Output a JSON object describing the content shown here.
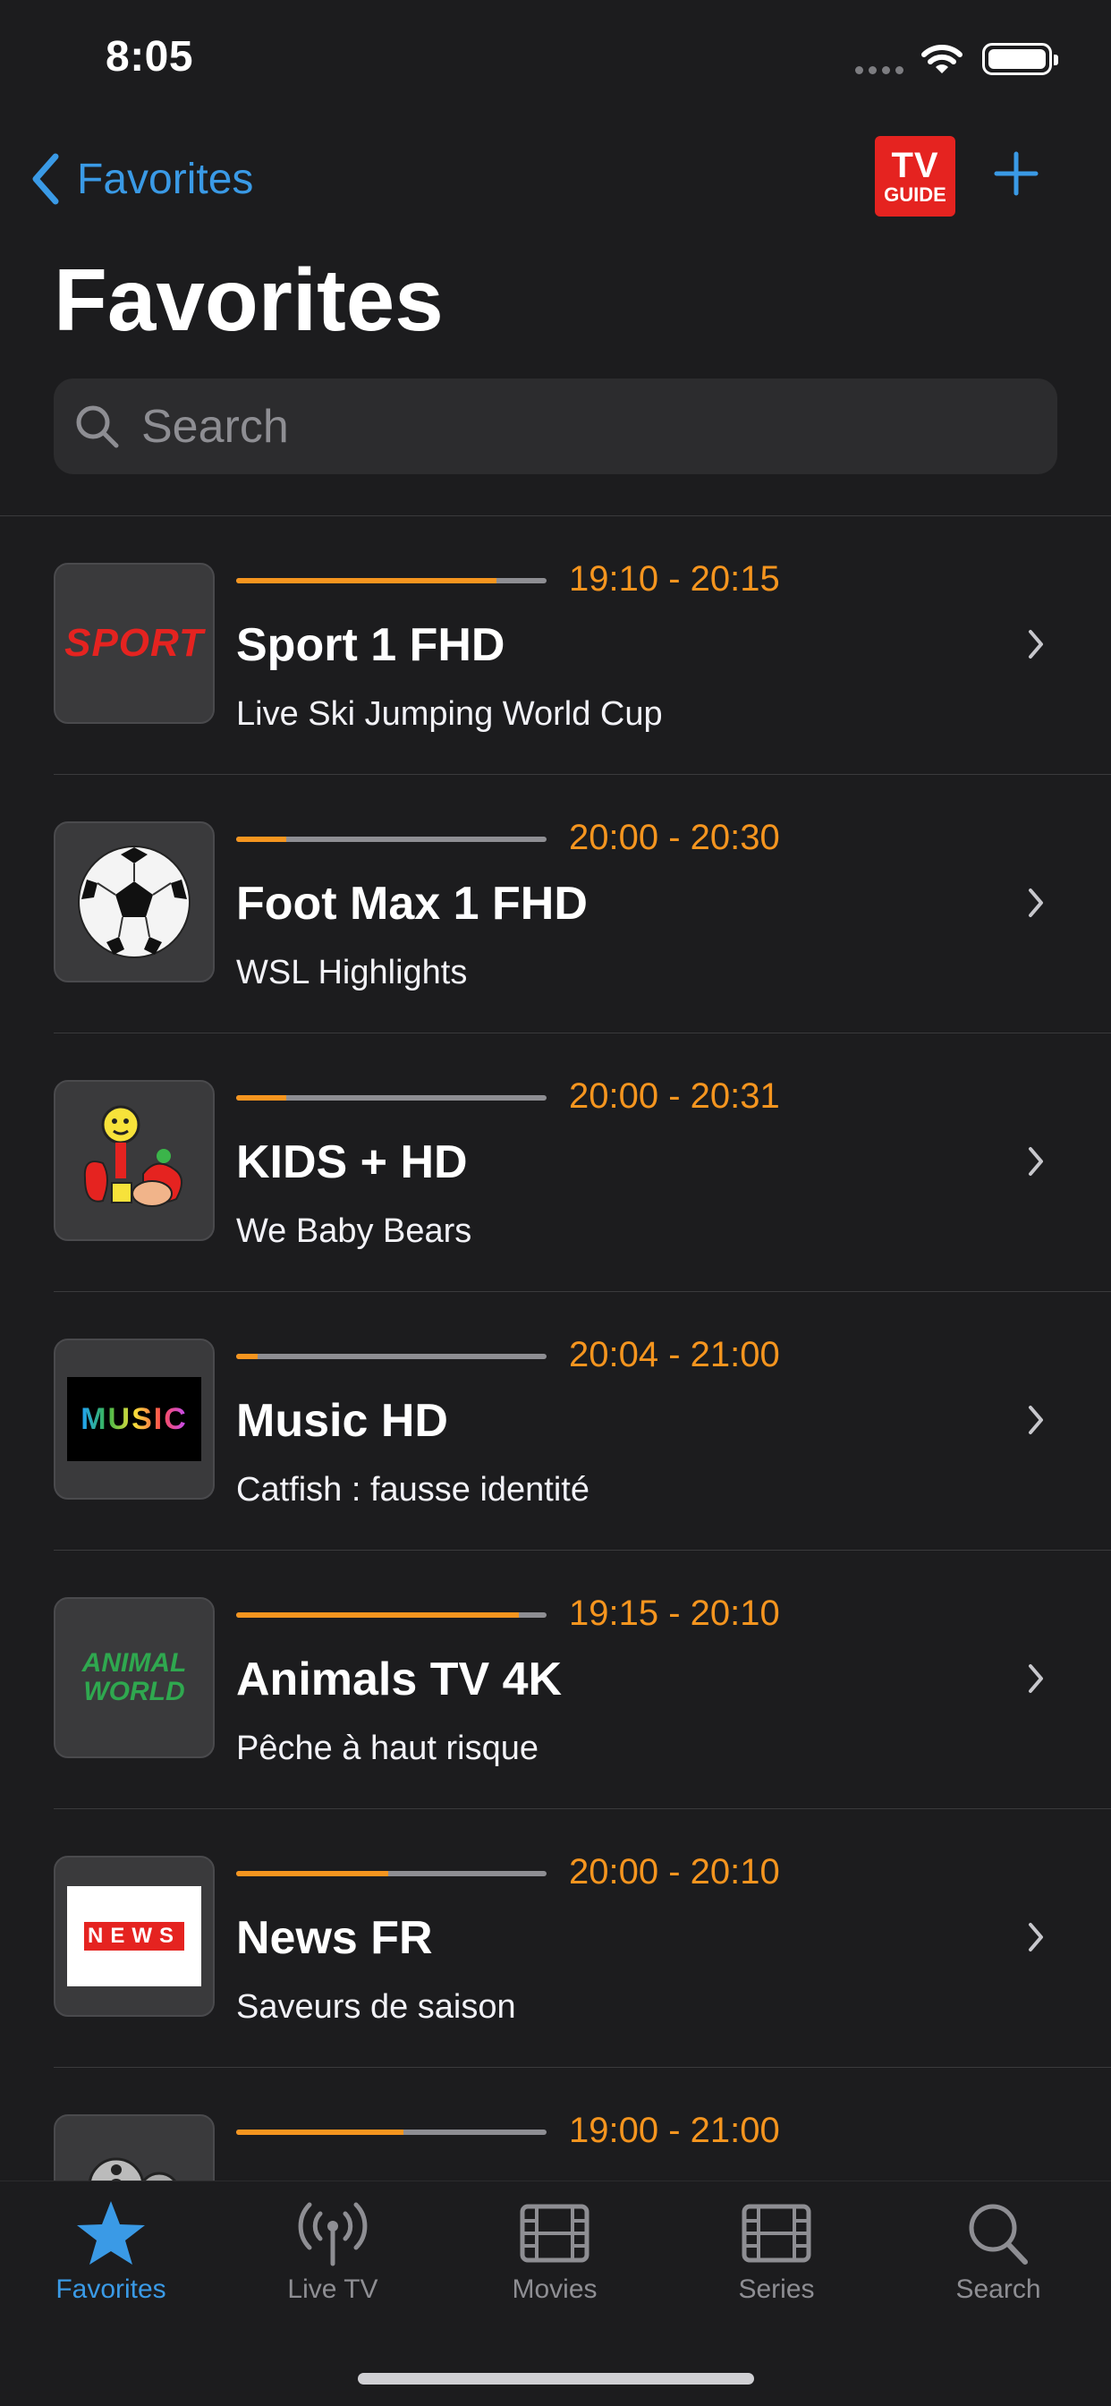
{
  "status_bar": {
    "time": "8:05"
  },
  "nav": {
    "back_label": "Favorites",
    "tvguide_line1": "TV",
    "tvguide_line2": "GUIDE",
    "title": "Favorites"
  },
  "search": {
    "placeholder": "Search"
  },
  "channels": [
    {
      "logo_text": "SPORT",
      "time_range": "19:10 - 20:15",
      "name": "Sport 1 FHD",
      "program": "Live Ski Jumping World Cup",
      "progress": 0.84
    },
    {
      "logo_text": "",
      "time_range": "20:00 - 20:30",
      "name": "Foot Max 1 FHD",
      "program": "WSL Highlights",
      "progress": 0.16
    },
    {
      "logo_text": "",
      "time_range": "20:00 - 20:31",
      "name": "KIDS + HD",
      "program": "We Baby Bears",
      "progress": 0.16
    },
    {
      "logo_text": "MUSIC",
      "time_range": "20:04 - 21:00",
      "name": "Music HD",
      "program": "Catfish : fausse identité",
      "progress": 0.07
    },
    {
      "logo_text": "ANIMAL WORLD",
      "time_range": "19:15 - 20:10",
      "name": "Animals TV 4K",
      "program": "Pêche à haut risque",
      "progress": 0.91
    },
    {
      "logo_text": "NEWS",
      "time_range": "20:00 - 20:10",
      "name": "News FR",
      "program": "Saveurs de saison",
      "progress": 0.49
    },
    {
      "logo_text": "",
      "time_range": "19:00 - 21:00",
      "name": "",
      "program": "",
      "progress": 0.54
    }
  ],
  "tabs": [
    {
      "label": "Favorites",
      "icon": "star-icon",
      "active": true
    },
    {
      "label": "Live TV",
      "icon": "antenna-icon",
      "active": false
    },
    {
      "label": "Movies",
      "icon": "film-icon",
      "active": false
    },
    {
      "label": "Series",
      "icon": "film-icon",
      "active": false
    },
    {
      "label": "Search",
      "icon": "search-icon",
      "active": false
    }
  ],
  "colors": {
    "accent": "#3a9ae6",
    "progress": "#f5951f",
    "background": "#1c1c1e"
  }
}
